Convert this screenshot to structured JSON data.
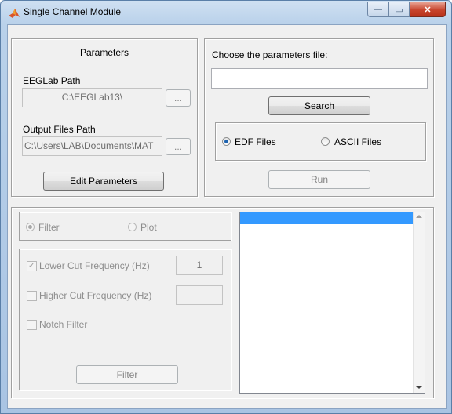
{
  "window": {
    "title": "Single Channel Module",
    "controls": {
      "minimize": "—",
      "maximize": "▭",
      "close": "✕"
    }
  },
  "parameters_panel": {
    "title": "Parameters",
    "eeglab_label": "EEGLab Path",
    "eeglab_value": "C:\\EEGLab13\\",
    "browse_label": "...",
    "output_label": "Output Files Path",
    "output_value": "C:\\Users\\LAB\\Documents\\MAT",
    "edit_button": "Edit Parameters"
  },
  "file_panel": {
    "prompt": "Choose the parameters file:",
    "file_value": "",
    "search_button": "Search",
    "file_types": [
      {
        "label": "EDF Files",
        "selected": true
      },
      {
        "label": "ASCII Files",
        "selected": false
      }
    ],
    "run_button": "Run"
  },
  "mode_group": {
    "options": [
      {
        "label": "Filter",
        "selected": true
      },
      {
        "label": "Plot",
        "selected": false
      }
    ]
  },
  "filter_group": {
    "lower_cut_label": "Lower Cut Frequency (Hz)",
    "lower_cut_checked": true,
    "lower_cut_value": "1",
    "higher_cut_label": "Higher Cut Frequency (Hz)",
    "higher_cut_checked": false,
    "higher_cut_value": "",
    "notch_label": "Notch Filter",
    "notch_checked": false,
    "filter_button": "Filter"
  },
  "listbox": {
    "items": [
      ""
    ],
    "selected_index": 0
  },
  "colors": {
    "titlebar": "#b9d1ea",
    "panel_bg": "#f0f0f0",
    "selection": "#3399ff",
    "close_button": "#c7432c"
  }
}
